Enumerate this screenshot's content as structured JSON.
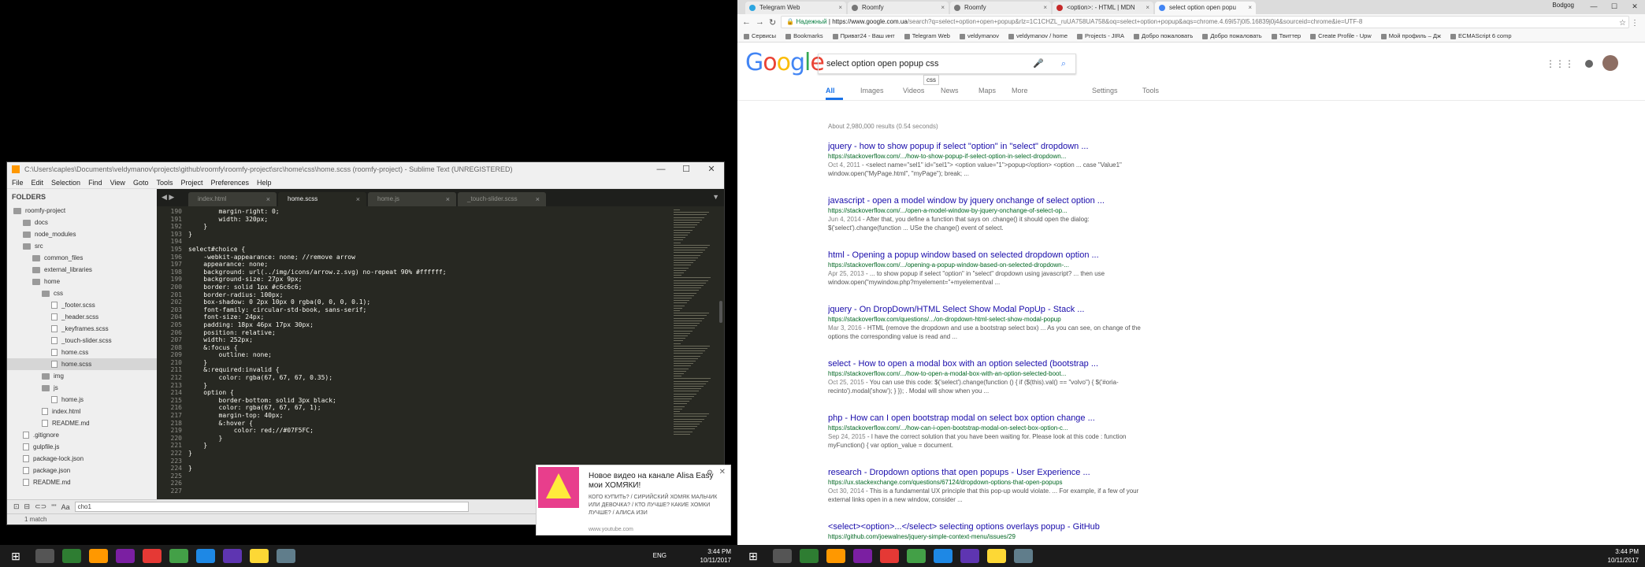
{
  "sublime": {
    "title": "C:\\Users\\caples\\Documents\\veldymanov\\projects\\github\\roomfy\\roomfy-project\\src\\home\\css\\home.scss (roomfy-project) - Sublime Text (UNREGISTERED)",
    "menu": [
      "File",
      "Edit",
      "Selection",
      "Find",
      "View",
      "Goto",
      "Tools",
      "Project",
      "Preferences",
      "Help"
    ],
    "folders_label": "FOLDERS",
    "tree": [
      {
        "label": "roomfy-project",
        "type": "folder",
        "depth": 0
      },
      {
        "label": "docs",
        "type": "folder",
        "depth": 1
      },
      {
        "label": "node_modules",
        "type": "folder",
        "depth": 1
      },
      {
        "label": "src",
        "type": "folder",
        "depth": 1
      },
      {
        "label": "common_files",
        "type": "folder",
        "depth": 2
      },
      {
        "label": "external_libraries",
        "type": "folder",
        "depth": 2
      },
      {
        "label": "home",
        "type": "folder",
        "depth": 2
      },
      {
        "label": "css",
        "type": "folder",
        "depth": 3
      },
      {
        "label": "_footer.scss",
        "type": "file",
        "depth": 4
      },
      {
        "label": "_header.scss",
        "type": "file",
        "depth": 4
      },
      {
        "label": "_keyframes.scss",
        "type": "file",
        "depth": 4
      },
      {
        "label": "_touch-slider.scss",
        "type": "file",
        "depth": 4
      },
      {
        "label": "home.css",
        "type": "file",
        "depth": 4
      },
      {
        "label": "home.scss",
        "type": "file",
        "depth": 4,
        "selected": true
      },
      {
        "label": "img",
        "type": "folder",
        "depth": 3
      },
      {
        "label": "js",
        "type": "folder",
        "depth": 3
      },
      {
        "label": "home.js",
        "type": "file",
        "depth": 4
      },
      {
        "label": "index.html",
        "type": "file",
        "depth": 3
      },
      {
        "label": "README.md",
        "type": "file",
        "depth": 3
      },
      {
        "label": ".gitignore",
        "type": "file",
        "depth": 1
      },
      {
        "label": "gulpfile.js",
        "type": "file",
        "depth": 1
      },
      {
        "label": "package-lock.json",
        "type": "file",
        "depth": 1
      },
      {
        "label": "package.json",
        "type": "file",
        "depth": 1
      },
      {
        "label": "README.md",
        "type": "file",
        "depth": 1
      }
    ],
    "tabs": [
      {
        "label": "index.html",
        "active": false
      },
      {
        "label": "home.scss",
        "active": true
      },
      {
        "label": "home.js",
        "active": false
      },
      {
        "label": "_touch-slider.scss",
        "active": false
      }
    ],
    "line_numbers": [
      "190",
      "191",
      "192",
      "193",
      "194",
      "195",
      "196",
      "197",
      "198",
      "199",
      "200",
      "201",
      "202",
      "203",
      "204",
      "205",
      "206",
      "207",
      "208",
      "209",
      "210",
      "211",
      "212",
      "213",
      "214",
      "215",
      "216",
      "217",
      "218",
      "219",
      "220",
      "221",
      "222",
      "223",
      "224",
      "225",
      "226",
      "227"
    ],
    "code": [
      "        margin-right: 0;",
      "        width: 320px;",
      "    }",
      "}",
      "",
      "select#choice {",
      "    -webkit-appearance: none; //remove arrow",
      "    appearance: none;",
      "    background: url(../img/icons/arrow.z.svg) no-repeat 90% #ffffff;",
      "    background-size: 27px 9px;",
      "    border: solid 1px #c6c6c6;",
      "    border-radius: 100px;",
      "    box-shadow: 0 2px 10px 0 rgba(0, 0, 0, 0.1);",
      "    font-family: circular-std-book, sans-serif;",
      "    font-size: 24px;",
      "    padding: 18px 46px 17px 30px;",
      "    position: relative;",
      "    width: 252px;",
      "    &:focus {",
      "        outline: none;",
      "    }",
      "    &:required:invalid {",
      "        color: rgba(67, 67, 67, 0.35);",
      "    }",
      "    option {",
      "        border-bottom: solid 3px black;",
      "        color: rgba(67, 67, 67, 1);",
      "        margin-top: 40px;",
      "        &:hover {",
      "            color: red;//#07F5FC;",
      "        }",
      "    }",
      "}",
      "",
      "}",
      "",
      "",
      ""
    ],
    "find_value": "cho1",
    "find_icons": [
      "Aa",
      "\"\"",
      "⊂⊃",
      "⊟",
      "⊡"
    ],
    "status": "1 match"
  },
  "toast": {
    "title": "Новое видео на канале Alisa Easy мои ХОМЯКИ!",
    "body": "КОГО КУПИТЬ? / СИРИЙСКИЙ ХОМЯК МАЛЬЧИК ИЛИ ДЕВОЧКА? / КТО ЛУЧШЕ? КАКИЕ ХОМКИ ЛУЧШЕ? / АЛИСА ИЗИ",
    "source": "www.youtube.com"
  },
  "taskbar": {
    "lang": "ENG",
    "time": "3:44 PM",
    "date": "10/11/2017"
  },
  "chrome": {
    "tabs": [
      {
        "label": "Telegram Web",
        "color": "#2ca5e0",
        "active": false
      },
      {
        "label": "Roomfy",
        "color": "#777777",
        "active": false
      },
      {
        "label": "Roomfy",
        "color": "#777777",
        "active": false
      },
      {
        "label": "<option>: - HTML | MDN",
        "color": "#c62828",
        "active": false
      },
      {
        "label": "select option open popu",
        "color": "#4285f4",
        "active": true
      }
    ],
    "user": "Bodgog",
    "secure_label": "Надежный",
    "url_host": "https://www.google.com.ua",
    "url_rest": "/search?q=select+option+open+popup&rlz=1C1CHZL_ruUA758UA758&oq=select+option+popup&aqs=chrome.4.69i57j0l5.16839j0j4&sourceid=chrome&ie=UTF-8",
    "bookmarks": [
      "Сервисы",
      "Bookmarks",
      "Приват24 - Ваш инт",
      "Telegram Web",
      "veldymanov",
      "veldymanov / home",
      "Projects - JIRA",
      "Добро пожаловать",
      "Добро пожаловать",
      "Твиттер",
      "Create Profile - Upw",
      "Мой профиль – Дж",
      "ECMAScript 6 comp"
    ]
  },
  "google": {
    "query": "select option open popup css",
    "suggestion": "css",
    "nav": [
      "All",
      "Images",
      "Videos",
      "News",
      "Maps",
      "More",
      "Settings",
      "Tools"
    ],
    "stats": "About 2,980,000 results (0.54 seconds)",
    "results": [
      {
        "title": "jquery - how to show popup if select \"option\" in \"select\" dropdown ...",
        "url": "https://stackoverflow.com/.../how-to-show-popup-if-select-option-in-select-dropdown...",
        "date": "Oct 4, 2011",
        "snippet": " - <select name=\"sel1\" id=\"sel1\"> <option value=\"1\">popup</option> <option ... case \"Value1\" window.open(\"MyPage.html\", \"myPage\"); break; ..."
      },
      {
        "title": "javascript - open a model window by jquery onchange of select option ...",
        "url": "https://stackoverflow.com/.../open-a-model-window-by-jquery-onchange-of-select-op...",
        "date": "Jun 4, 2014",
        "snippet": " - After that, you define a function that says on .change() it should open the dialog: $('select').change(function ... USe the change() event of select."
      },
      {
        "title": "html - Opening a popup window based on selected dropdown option ...",
        "url": "https://stackoverflow.com/.../opening-a-popup-window-based-on-selected-dropdown-...",
        "date": "Apr 25, 2013",
        "snippet": " - ... to show popup if select \"option\" in \"select\" dropdown using javascript? ... then use window.open(\"mywindow.php?myelement=\"+myelementval ..."
      },
      {
        "title": "jquery - On DropDown/HTML Select Show Modal PopUp - Stack ...",
        "url": "https://stackoverflow.com/questions/.../on-dropdown-html-select-show-modal-popup",
        "date": "Mar 3, 2016",
        "snippet": " - HTML (remove the dropdown and use a bootstrap select box) ... As you can see, on change of the options the corresponding value is read and ..."
      },
      {
        "title": "select - How to open a modal box with an option selected (bootstrap ...",
        "url": "https://stackoverflow.com/.../how-to-open-a-modal-box-with-an-option-selected-boot...",
        "date": "Oct 25, 2015",
        "snippet": " - You can use this code: $('select').change(function () { if ($(this).val() == \"volvo\") { $('#oria-recinto').modal('show'); } }); . Modal will show when you ..."
      },
      {
        "title": "php - How can I open bootstrap modal on select box option change ...",
        "url": "https://stackoverflow.com/.../how-can-i-open-bootstrap-modal-on-select-box-option-c...",
        "date": "Sep 24, 2015",
        "snippet": " - I have the correct solution that you have been waiting for. Please look at this code : function myFunction() { var option_value = document."
      },
      {
        "title": "research - Dropdown options that open popups - User Experience ...",
        "url": "https://ux.stackexchange.com/questions/67124/dropdown-options-that-open-popups",
        "date": "Oct 30, 2014",
        "snippet": " - This is a fundamental UX principle that this pop-up would violate. ... For example, if a few of your external links open in a new window, consider ..."
      },
      {
        "title": "<select><option>...</select> selecting options overlays popup - GitHub",
        "url": "https://github.com/joewalnes/jquery-simple-context-menu/issues/29",
        "date": "",
        "snippet": ""
      }
    ]
  }
}
